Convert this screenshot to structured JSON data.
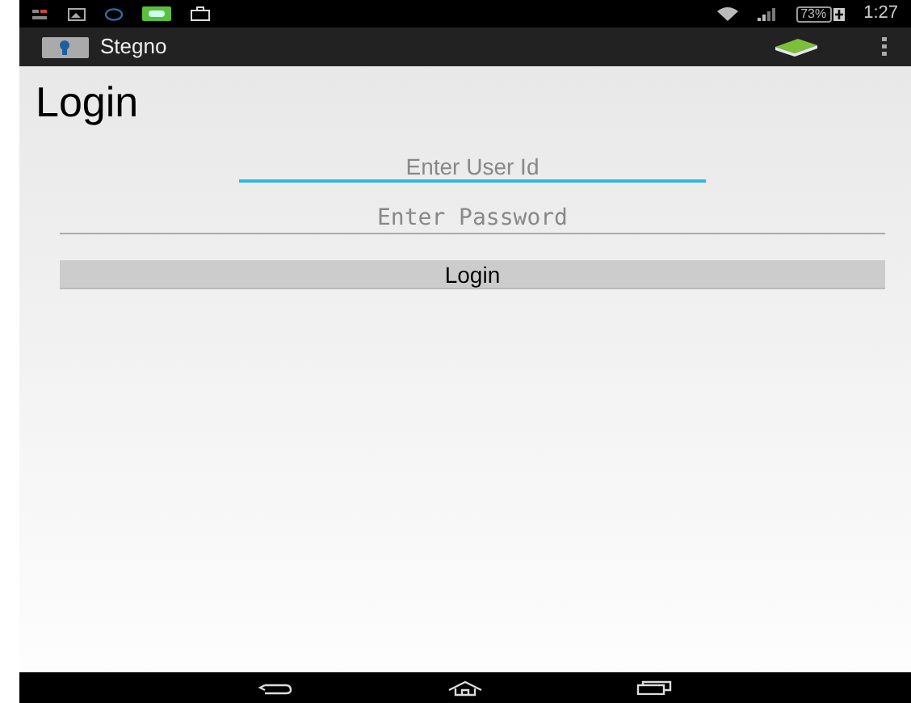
{
  "status_bar": {
    "battery": "73%",
    "time": "1:27"
  },
  "action_bar": {
    "title": "Stegno"
  },
  "page": {
    "heading": "Login"
  },
  "fields": [
    {
      "kind": "text",
      "placeholder": "Enter User Id",
      "focused": true
    },
    {
      "kind": "password",
      "placeholder": "Enter Password",
      "focused": false
    }
  ],
  "button": {
    "label": "Login"
  }
}
